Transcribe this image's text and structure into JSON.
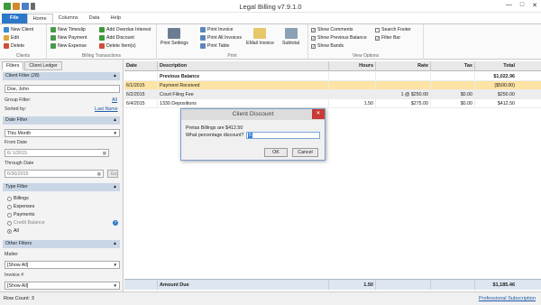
{
  "window": {
    "title": "Legal Billing v7.9.1.0"
  },
  "quick_access": [
    {
      "color": "#3c9a3c"
    },
    {
      "color": "#d28a2a"
    },
    {
      "color": "#4a7fc7"
    },
    {
      "color": "#6a6a6a"
    }
  ],
  "window_controls": {
    "minimize": "—",
    "maximize": "□",
    "close": "✕"
  },
  "tabs": [
    {
      "label": "File"
    },
    {
      "label": "Home"
    },
    {
      "label": "Columns"
    },
    {
      "label": "Data"
    },
    {
      "label": "Help"
    }
  ],
  "ribbon": {
    "clients": {
      "label": "Clients",
      "items": [
        "New Client",
        "Edit",
        "Delete"
      ]
    },
    "billing": {
      "label": "Billing Transactions",
      "col1": [
        "New Timeslip",
        "New Payment",
        "New Expense"
      ],
      "col2": [
        "Add Overdue Interest",
        "Add Discount",
        "Delete Item(s)"
      ]
    },
    "print": {
      "label": "Print",
      "big": "Print Settings",
      "small": [
        "Print Invoice",
        "Print All Invoices",
        "Print Table"
      ],
      "email": "EMail Invoice",
      "subtotal": "Subtotal"
    },
    "view": {
      "label": "View Options",
      "col1": [
        "Show Comments",
        "Show Previous Balance",
        "Show Bands"
      ],
      "col2": [
        "Search Footer",
        "Filter Bar"
      ],
      "checked1": [
        true,
        true,
        true
      ],
      "checked2": [
        false,
        true
      ]
    }
  },
  "left": {
    "tabs": [
      "Filters",
      "Client Ledger"
    ],
    "client_filter": "Client Filter (28)",
    "client_value": "Doe, John",
    "group_filter_label": "Group Filter:",
    "group_filter_value": "All",
    "sorted_by_label": "Sorted by:",
    "sorted_by_value": "Last Name",
    "date_filter": "Date Filter",
    "date_value": "This Month",
    "from_date_label": "From Date",
    "from_date": "6/  1/2015",
    "through_date_label": "Through Date",
    "through_date": "6/30/2015",
    "go": "Go",
    "type_filter": "Type Filter",
    "types": [
      "Billings",
      "Expenses",
      "Payments",
      "Credit Balance",
      "All"
    ],
    "other_filters": "Other Filters",
    "matter_label": "Matter",
    "matter_value": "[Show All]",
    "invoice_label": "Invoice #",
    "invoice_value": "[Show All]"
  },
  "grid": {
    "headers": [
      "Date",
      "Description",
      "Hours",
      "Rate",
      "Tax",
      "Total"
    ],
    "rows": [
      {
        "date": "",
        "desc": "Previous Balance",
        "hours": "",
        "rate": "",
        "tax": "",
        "total": "$1,022.96",
        "bold": true,
        "bg": "#ffffff"
      },
      {
        "date": "6/1/2015",
        "desc": "Payment Received",
        "hours": "",
        "rate": "",
        "tax": "",
        "total": "($500.00)",
        "bold": false,
        "bg": "#fde3a4"
      },
      {
        "date": "6/2/2015",
        "desc": "Court Filing Fee",
        "hours": "",
        "rate": "1 @ $250.00",
        "tax": "$0.00",
        "total": "$250.00",
        "bold": false,
        "bg": "#ededed"
      },
      {
        "date": "6/4/2015",
        "desc": "1330 Depositions",
        "hours": "1.50",
        "rate": "$275.00",
        "tax": "$0.00",
        "total": "$412.50",
        "bold": false,
        "bg": "#ffffff"
      }
    ],
    "footer": {
      "label": "Amount Due",
      "hours": "1.50",
      "total": "$1,185.46"
    }
  },
  "dialog": {
    "title": "Client Discount",
    "line1": "Pretax Billings are $412.50",
    "line2": "What percentage discount?",
    "input_value": "5",
    "ok": "OK",
    "cancel": "Cancel"
  },
  "status": {
    "row_count": "Row Count: 3",
    "subscription": "Professional Subscription"
  }
}
